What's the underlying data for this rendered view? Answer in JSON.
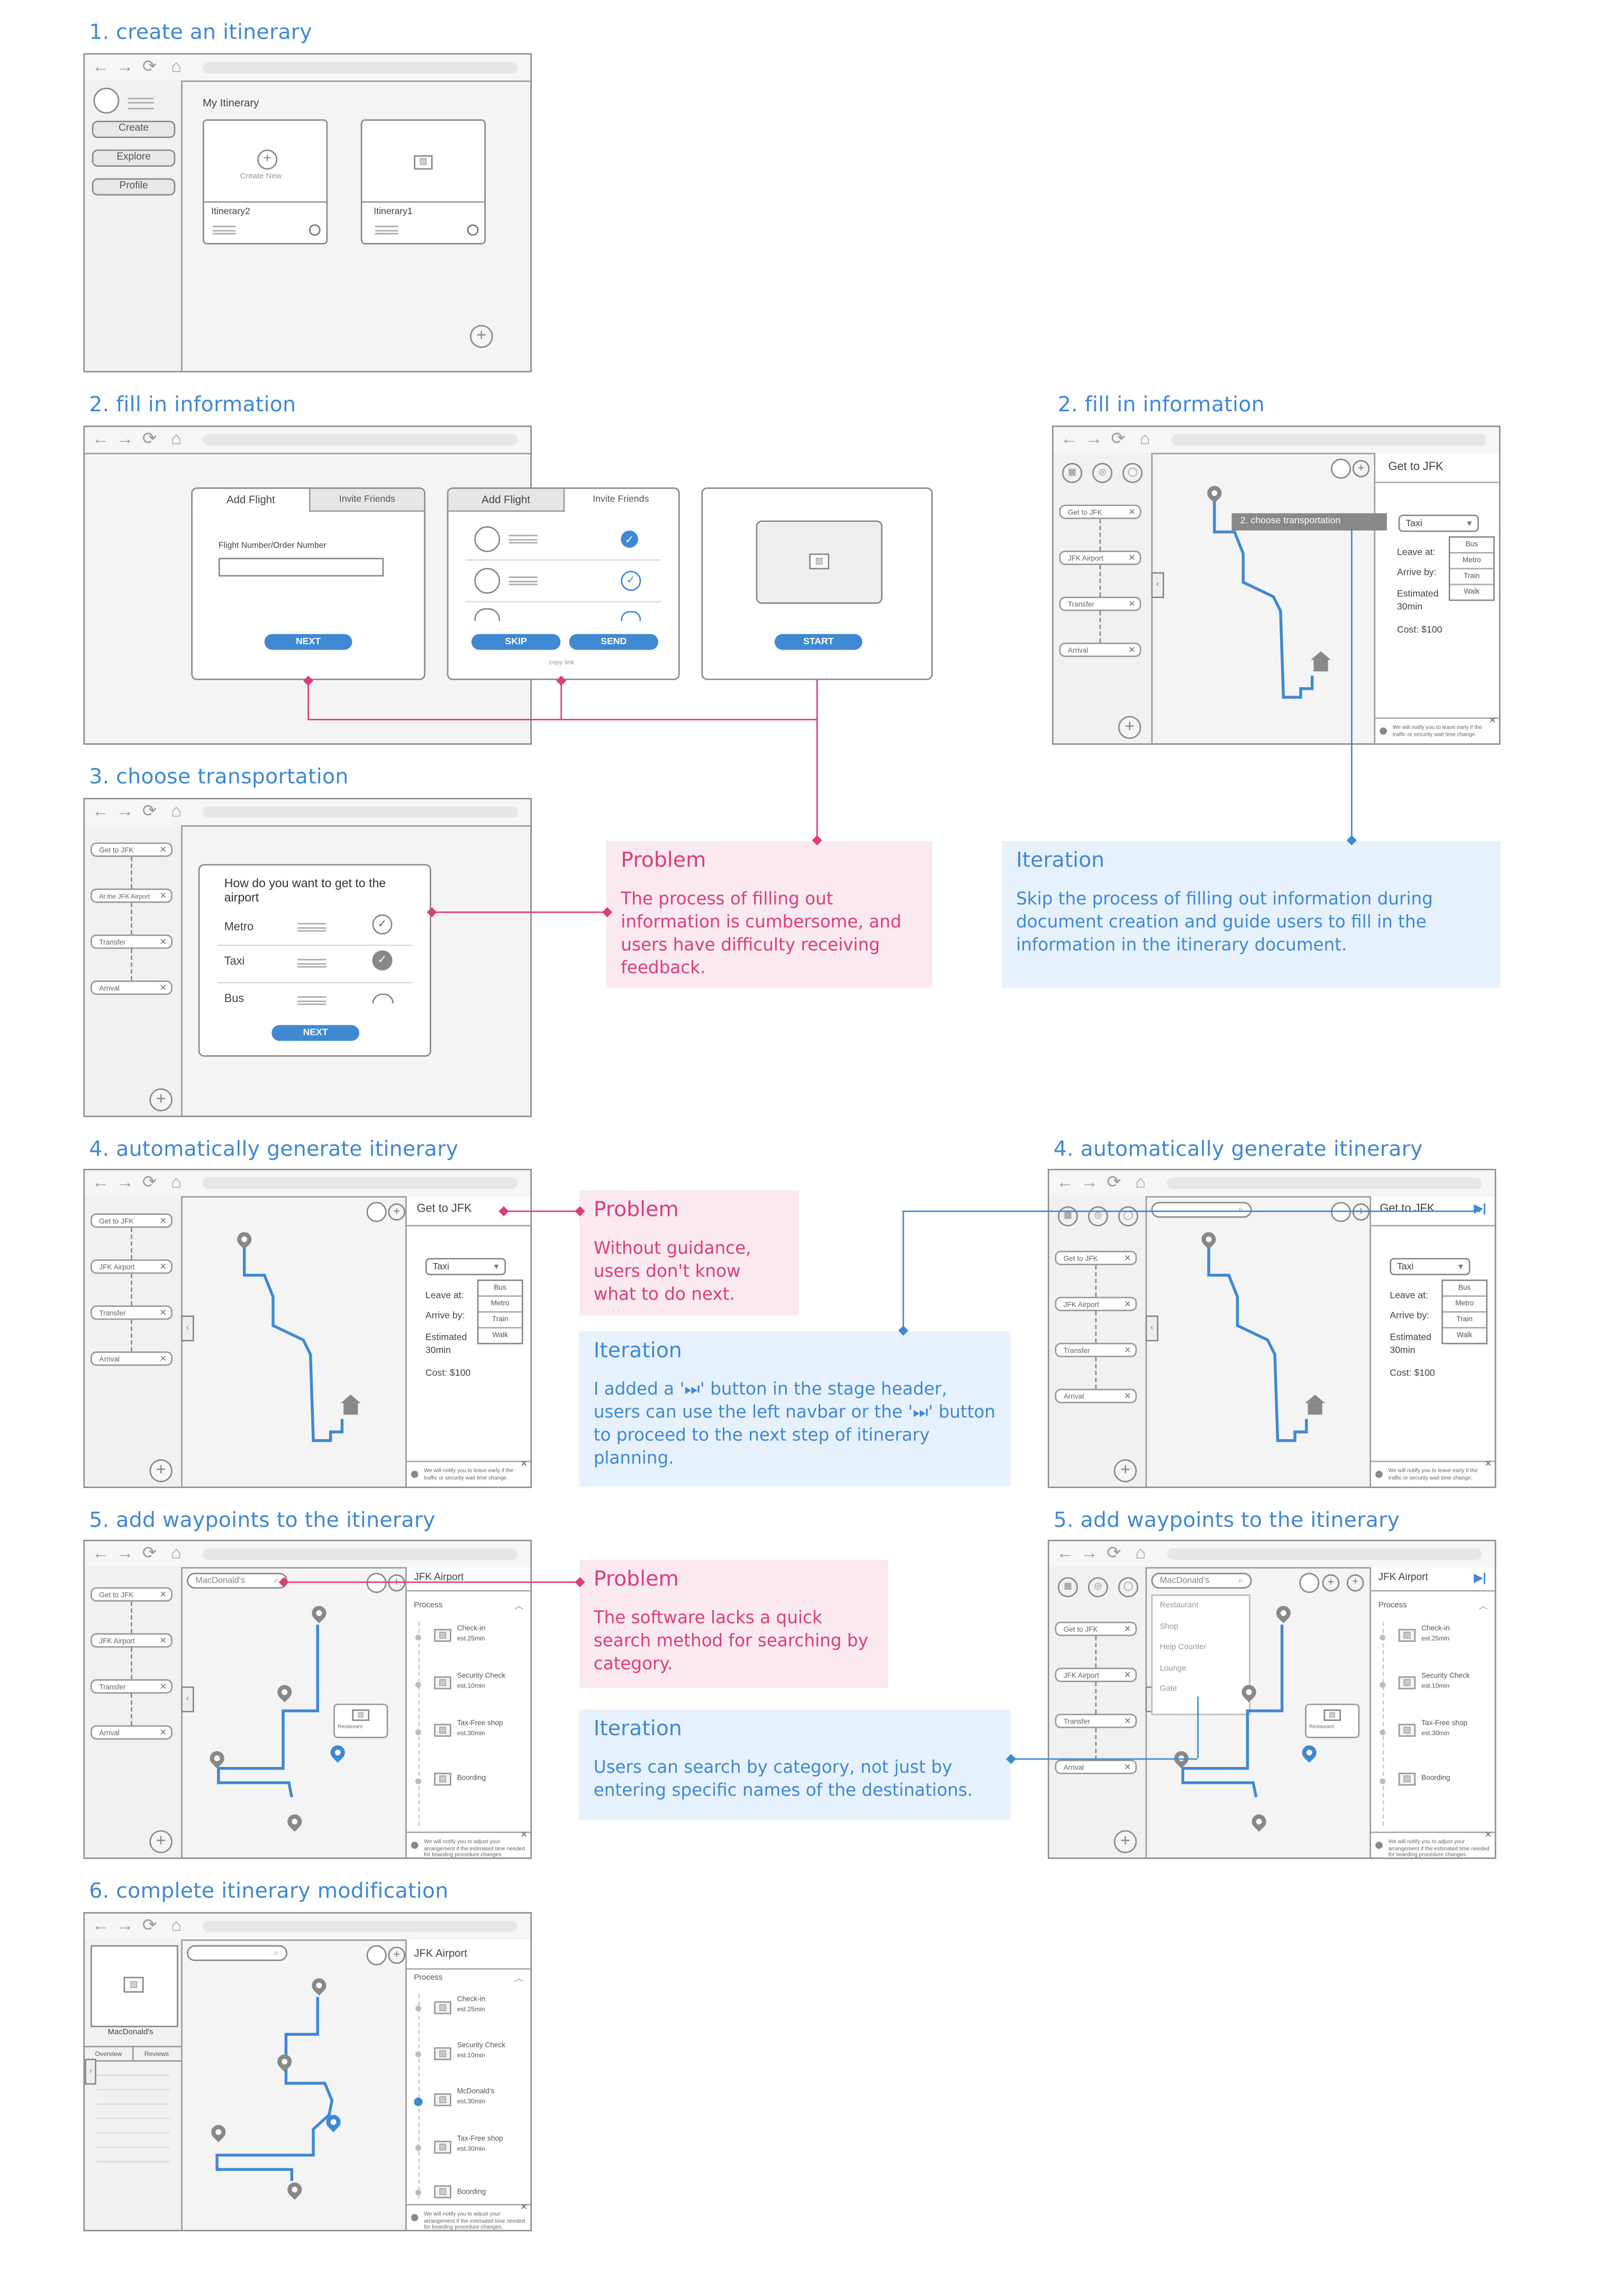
{
  "sections": {
    "s1": "1. create an itinerary",
    "s2a": "2. fill in information",
    "s2b": "2. fill in information",
    "s3": "3. choose transportation",
    "s4a": "4. automatically generate itinerary",
    "s4b": "4. automatically generate itinerary",
    "s5a": "5. add waypoints to the itinerary",
    "s5b": "5. add waypoints to the itinerary",
    "s6": "6. complete itinerary modification"
  },
  "create": {
    "nav": [
      "Create",
      "Explore",
      "Profile"
    ],
    "heading": "My Itinerary",
    "create_new": "Create New",
    "cards": [
      "Itinerary2",
      "Itinerary1"
    ]
  },
  "fill": {
    "tab_add_flight": "Add Flight",
    "tab_invite": "Invite Friends",
    "flight_label": "Flight Number/Order Number",
    "next": "NEXT",
    "skip": "SKIP",
    "send": "SEND",
    "copy_link": "copy link",
    "start": "START"
  },
  "stages": {
    "get_to_jfk": "Get to JFK",
    "at_jfk": "At the JFK Airport",
    "jfk_airport": "JFK Airport",
    "transfer": "Transfer",
    "arrival": "Arrival"
  },
  "transport": {
    "question": "How do you want to get to the airport",
    "options": [
      "Metro",
      "Taxi",
      "Bus"
    ],
    "next": "NEXT"
  },
  "panel": {
    "title": "Get to JFK",
    "mode": "Taxi",
    "mode_options": [
      "Bus",
      "Metro",
      "Train",
      "Walk"
    ],
    "leave": "Leave at:",
    "arrive": "Arrive by:",
    "estimated": "Estimated",
    "duration": "30min",
    "cost": "Cost: $100",
    "tooltip": "2. choose transportation",
    "footer": "We will notify you to leave early if the traffic or security wait time change."
  },
  "waypoints": {
    "search": "MacDonald's",
    "title": "JFK Airport",
    "process": "Process",
    "steps": [
      {
        "name": "Check-in",
        "est": "est.25min"
      },
      {
        "name": "Security Check",
        "est": "est.10min"
      },
      {
        "name": "Tax-Free shop",
        "est": "est.30min"
      },
      {
        "name": "Boording",
        "est": ""
      }
    ],
    "categories": [
      "Restaurant",
      "Shop",
      "Help Counter",
      "Lounge",
      "Gate"
    ],
    "map_card": "Restaurant",
    "footer": "We will notify you to adjust your arrangement if the estimated time needed for boarding procedure changes."
  },
  "complete": {
    "place": "MacDonald's",
    "tabs": [
      "Overview",
      "Reviews"
    ],
    "steps": [
      {
        "name": "Check-in",
        "est": "est.25min"
      },
      {
        "name": "Security Check",
        "est": "est.10min"
      },
      {
        "name": "McDonald's",
        "est": "est.30min"
      },
      {
        "name": "Tax-Free shop",
        "est": "est.30min"
      },
      {
        "name": "Boording",
        "est": ""
      }
    ]
  },
  "notes": {
    "p1_title": "Problem",
    "p1_body": "The process of filling out information is cumbersome, and users have difficulty receiving feedback.",
    "i1_title": "Iteration",
    "i1_body": "Skip the process of filling out information during document creation and guide users to fill in the information in the itinerary document.",
    "p2_title": "Problem",
    "p2_body": "Without guidance, users don't know what to do next.",
    "i2_title": "Iteration",
    "i2_body": "I added a '⏭' button in the stage header, users can use the left navbar or the '⏭' button to proceed to the next step of itinerary planning.",
    "p3_title": "Problem",
    "p3_body": "The software lacks a quick search method for searching by category.",
    "i3_title": "Iteration",
    "i3_body": "Users can search by category, not just by entering specific names of the destinations."
  },
  "colors": {
    "accent": "#3f88d2",
    "problem": "#db3d7d",
    "problem_bg": "#fbe9f0",
    "iteration_bg": "#e7f1fb"
  }
}
